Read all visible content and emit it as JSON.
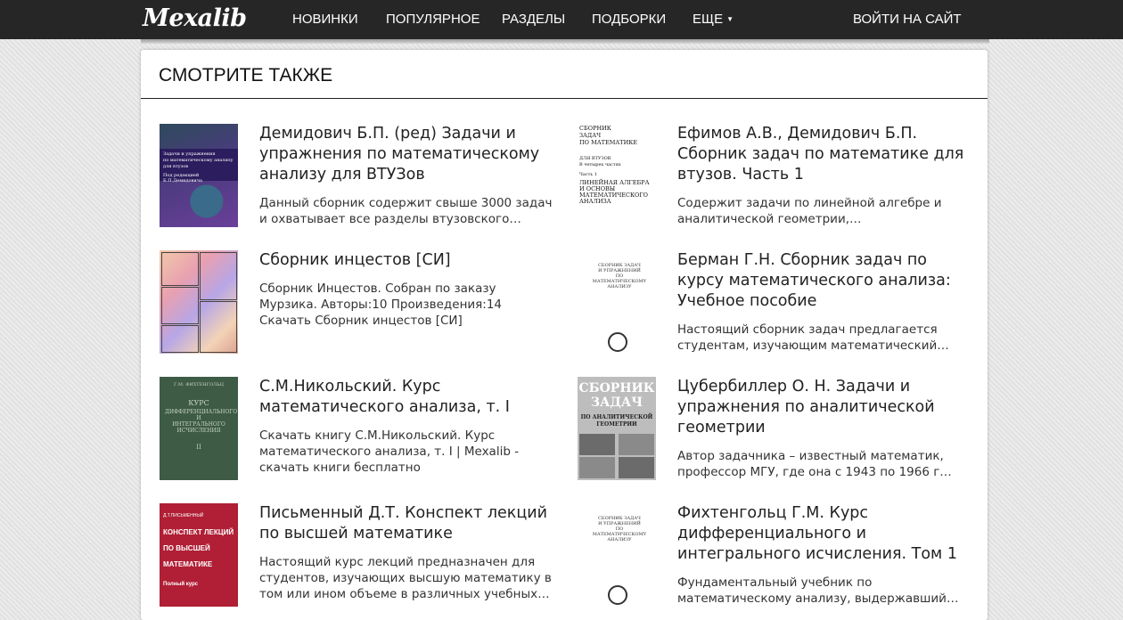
{
  "site": {
    "logo": "Mexalib",
    "nav": [
      {
        "label": "НОВИНКИ"
      },
      {
        "label": "ПОПУЛЯРНОЕ"
      },
      {
        "label": "РАЗДЕЛЫ"
      },
      {
        "label": "ПОДБОРКИ"
      },
      {
        "label": "ЕЩЕ"
      }
    ],
    "nav_more_caret": "▼",
    "login": "ВОЙТИ НА САЙТ"
  },
  "section": {
    "title": "СМОТРИТЕ ТАКЖЕ"
  },
  "books": [
    {
      "title": "Демидович Б.П. (ред) Задачи и упражнения по математическому анализу для ВТУЗов",
      "description": "Данный сборник содержит свыше 3000 задач и охватывает все разделы втузовского курса…",
      "cover_text": [
        "Задачи и упражнения",
        "по математическому анализу",
        "для втузов",
        "Под редакцией Б.П.Демидовича"
      ]
    },
    {
      "title": "Ефимов А.В., Демидович Б.П. Сборник задач по математике для втузов. Часть 1",
      "description": "Содержит задачи по линейной алгебре и аналитической геометрии, дифференциальному…",
      "cover_text": [
        "СБОРНИК",
        "ЗАДАЧ",
        "ПО МАТЕМАТИКЕ",
        "ДЛЯ ВТУЗОВ",
        "В четырех частях",
        "Часть 1",
        "ЛИНЕЙНАЯ АЛГЕБРА",
        "И ОСНОВЫ",
        "МАТЕМАТИЧЕСКОГО",
        "АНАЛИЗА"
      ]
    },
    {
      "title": "Сборник инцестов [СИ]",
      "description": "Сборник Инцестов. Собран по заказу Мурзика. Авторы:10 Произведения:14 Скачать Сборник инцестов [СИ]"
    },
    {
      "title": "Берман Г.Н. Сборник задач по курсу математического анализа: Учебное пособие",
      "description": "Настоящий сборник задач предлагается студентам, изучающим математический анализ…",
      "cover_text": [
        "СБОРНИК ЗАДАЧ",
        "И УПРАЖНЕНИЙ",
        "ПО",
        "МАТЕМАТИЧЕСКОМУ",
        "АНАЛИЗУ"
      ]
    },
    {
      "title": "С.М.Никольский. Курс математического анализа, т. I",
      "description": "Скачать книгу С.М.Никольский. Курс математического анализа, т. I | Mexalib - скачать книги бесплатно",
      "cover_text": [
        "Г.М. ФИХТЕНГОЛЬЦ",
        "КУРС",
        "ДИФФЕРЕНЦИАЛЬНОГО",
        "И",
        "ИНТЕГРАЛЬНОГО",
        "ИСЧИСЛЕНИЯ",
        "II"
      ]
    },
    {
      "title": "Цубербиллер О. Н. Задачи и упражнения по аналитической геометрии",
      "description": "Автор задачника – известный математик, профессор МГУ, где она с 1943 по 1966 г…",
      "cover_text": [
        "СБОРНИК",
        "ЗАДАЧ",
        "ПО АНАЛИТИЧЕСКОЙ",
        "ГЕОМЕТРИИ"
      ]
    },
    {
      "title": "Письменный Д.Т. Конспект лекций по высшей математике",
      "description": "Настоящий курс лекций предназначен для студентов, изучающих высшую математику в том или ином объеме в различных учебных…",
      "cover_text": [
        "Д.Т.ПИСЬМЕННЫЙ",
        "КОНСПЕКТ ЛЕКЦИЙ",
        "ПО ВЫСШЕЙ",
        "МАТЕМАТИКЕ",
        "Полный курс"
      ]
    },
    {
      "title": "Фихтенгольц Г.М. Курс дифференциального и интегрального исчисления. Том 1",
      "description": "Фундаментальный учебник по математическому анализу, выдержавший множество изданий и…",
      "cover_text": [
        "СБОРНИК ЗАДАЧ",
        "И УПРАЖНЕНИЙ",
        "ПО",
        "МАТЕМАТИЧЕСКОМУ",
        "АНАЛИЗУ"
      ]
    }
  ]
}
